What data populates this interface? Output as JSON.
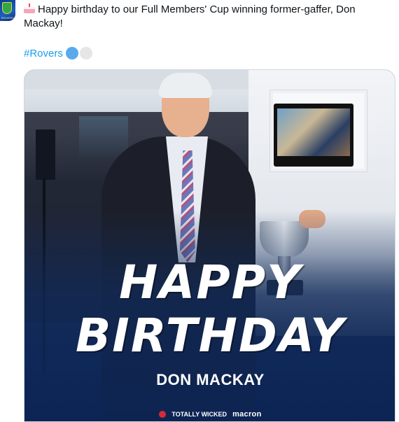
{
  "tweet": {
    "text": "Happy birthday to our Full Members' Cup winning former-gaffer, Don Mackay!",
    "emoji_icon": "birthday-cake-icon",
    "hashtag": "#Rovers",
    "hashtag_emojis": [
      "blue-circle-icon",
      "white-circle-icon"
    ]
  },
  "avatar": {
    "crest_text": "ROVERS"
  },
  "media": {
    "headline_line1": "HAPPY",
    "headline_line2": "BIRTHDAY",
    "name": "DON MACKAY",
    "sponsors": [
      "TOTALLY WICKED",
      "macron"
    ]
  },
  "colors": {
    "link": "#1d9bf0",
    "text": "#0f1419",
    "graphic_blue": "#14305f"
  }
}
